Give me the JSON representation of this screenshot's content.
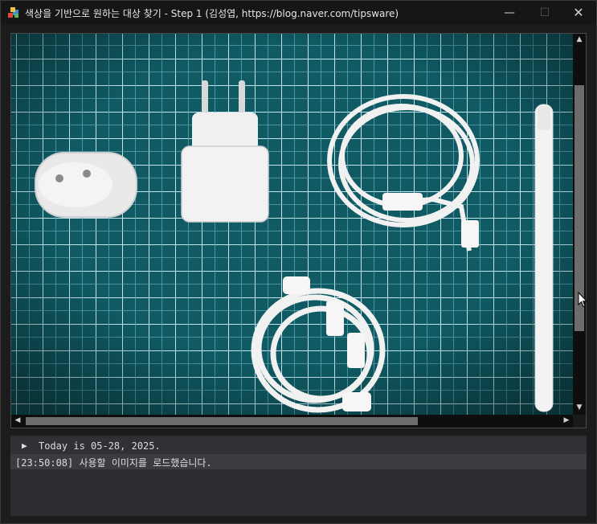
{
  "window": {
    "title": "색상을 기반으로 원하는 대상 찾기 - Step 1 (김성엽, https://blog.naver.com/tipsware)",
    "minimize": "—",
    "maximize": "☐",
    "close": "✕"
  },
  "image_view": {
    "icons": [
      "photo-of-chargers-and-cables"
    ]
  },
  "log": {
    "header": "Today is 05-28, 2025.",
    "header_marker": "▶",
    "entries": [
      {
        "text": "[23:50:08] 사용할 이미지를 로드했습니다."
      }
    ]
  },
  "colors": {
    "mat": "#0f5a63",
    "grid": "#bfe3ea",
    "panel": "#2b2d30"
  }
}
